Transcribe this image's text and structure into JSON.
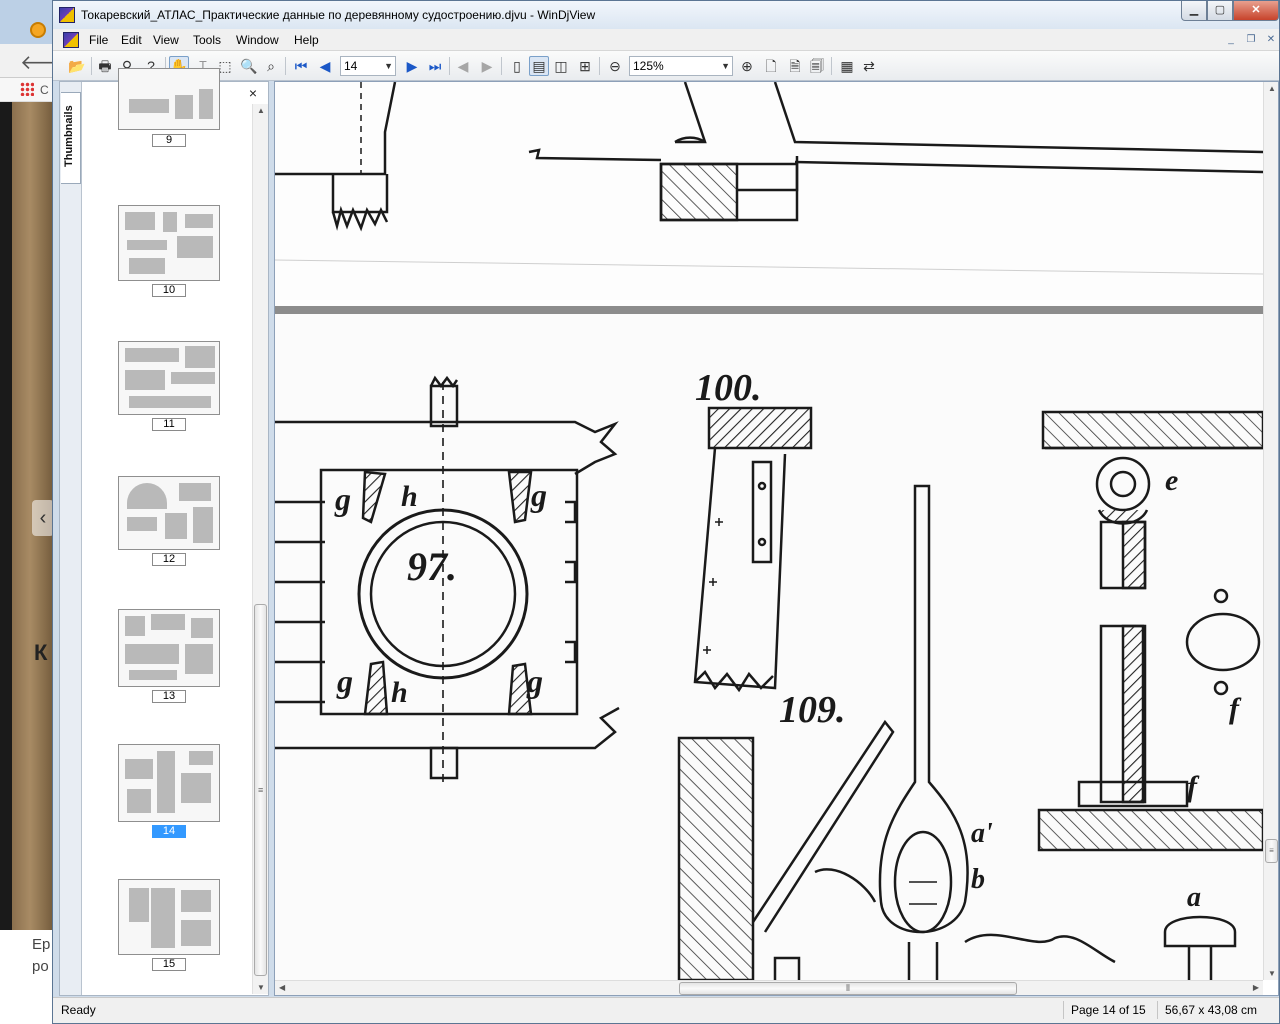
{
  "background_browser": {
    "bookmark_text": "С",
    "footer_lines": [
      "Ер",
      "ро"
    ],
    "page_letter": "К"
  },
  "window": {
    "title": "Токаревский_АТЛАС_Практические данные по деревянному судостроению.djvu - WinDjView",
    "controls": {
      "minimize": "▁",
      "maximize": "▢",
      "close": "✕"
    }
  },
  "menu": {
    "items": [
      "File",
      "Edit",
      "View",
      "Tools",
      "Window",
      "Help"
    ],
    "mdi_controls": [
      "_",
      "❐",
      "✕"
    ]
  },
  "toolbar": {
    "page_number": "14",
    "zoom": "125%",
    "icons": [
      "open-icon",
      "print-icon",
      "find-icon",
      "help-icon",
      "hand-tool-icon",
      "select-tool-icon",
      "rect-select-icon",
      "zoom-icon",
      "zoom-rect-icon",
      "first-page-icon",
      "prev-page-icon",
      "next-page-icon",
      "last-page-icon",
      "back-icon",
      "forward-icon",
      "single-page-icon",
      "continuous-icon",
      "facing-icon",
      "continuous-facing-icon",
      "zoom-out-icon",
      "zoom-in-icon",
      "fit-page-icon",
      "fit-width-icon",
      "actual-size-icon",
      "display-mode-icon",
      "rotate-icon"
    ]
  },
  "thumbnails": {
    "tab_label": "Thumbnails",
    "close_glyph": "×",
    "items": [
      {
        "page": "9",
        "selected": false
      },
      {
        "page": "10",
        "selected": false
      },
      {
        "page": "11",
        "selected": false
      },
      {
        "page": "12",
        "selected": false
      },
      {
        "page": "13",
        "selected": false
      },
      {
        "page": "14",
        "selected": true
      },
      {
        "page": "15",
        "selected": false
      }
    ]
  },
  "document": {
    "figure_labels": [
      "100.",
      "109.",
      "97.",
      "g",
      "g",
      "g",
      "g",
      "h",
      "h",
      "e",
      "f",
      "f",
      "a'",
      "b",
      "a"
    ]
  },
  "status": {
    "text": "Ready",
    "page": "Page 14 of 15",
    "size": "56,67 x 43,08 cm"
  }
}
